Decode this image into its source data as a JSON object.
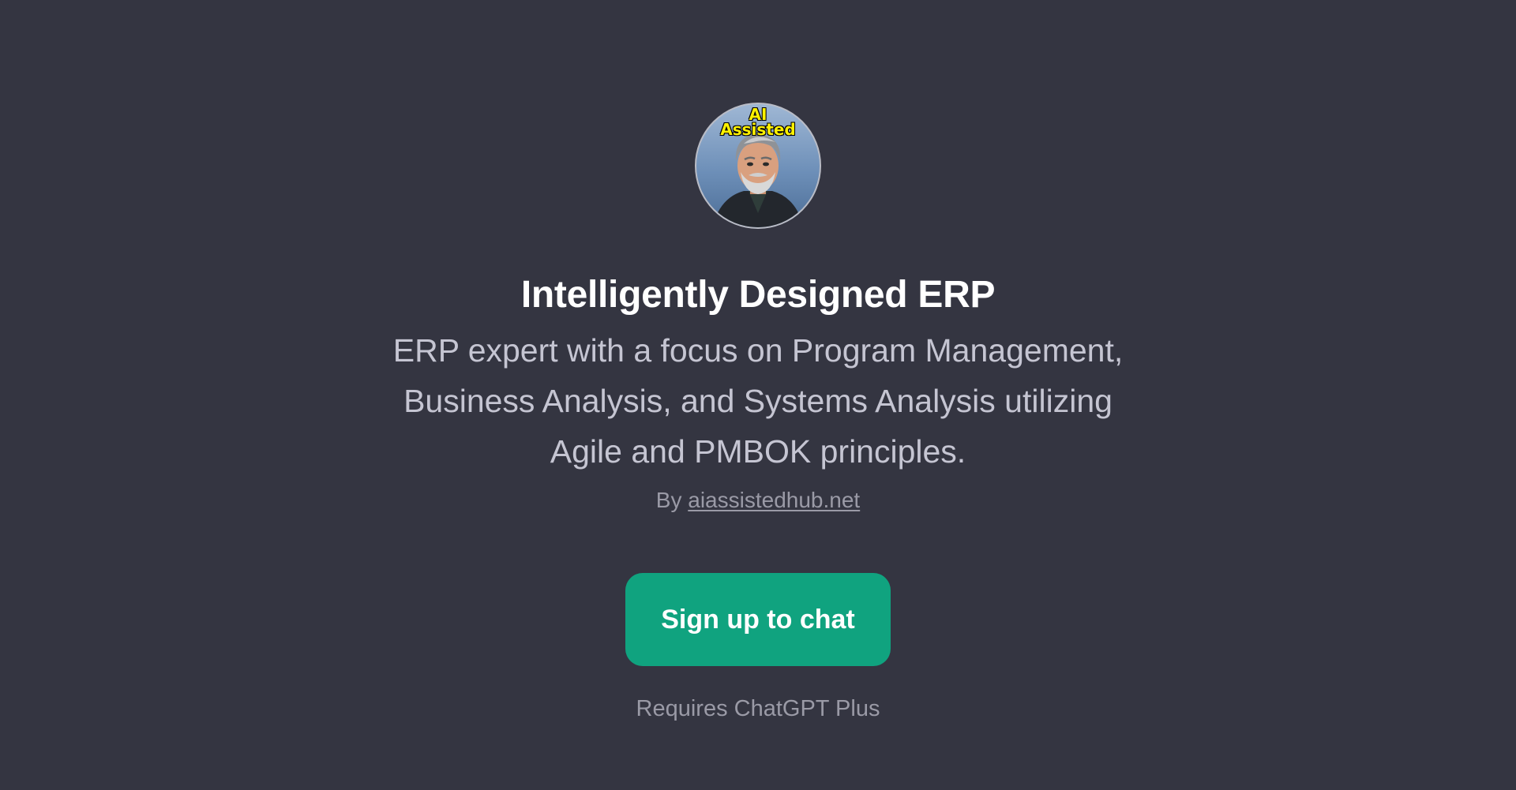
{
  "avatar": {
    "badge_line1": "AI",
    "badge_line2": "Assisted"
  },
  "gpt": {
    "title": "Intelligently Designed ERP",
    "description_line1": "ERP expert with a focus on Program Management,",
    "description_line2": "Business Analysis, and Systems Analysis utilizing",
    "description_line3": "Agile and PMBOK principles.",
    "by_prefix": "By",
    "author": "aiassistedhub.net"
  },
  "actions": {
    "signup_label": "Sign up to chat",
    "requirement": "Requires ChatGPT Plus"
  },
  "colors": {
    "background": "#343541",
    "accent": "#10a37f",
    "badge_text": "#fff200"
  }
}
